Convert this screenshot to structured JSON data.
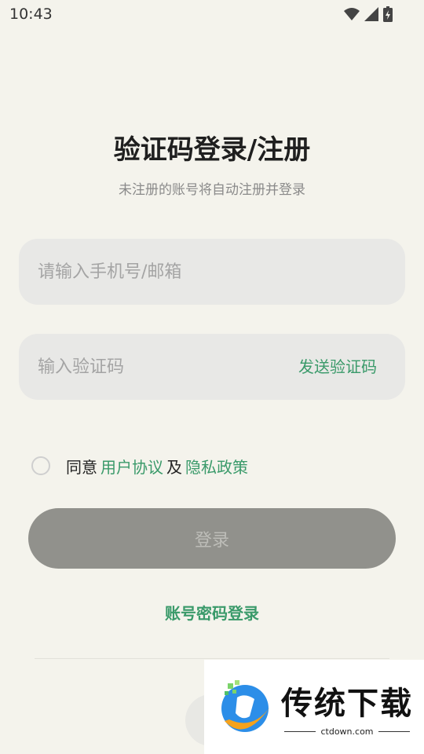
{
  "status_bar": {
    "time": "10:43"
  },
  "header": {
    "title": "验证码登录/注册",
    "subtitle": "未注册的账号将自动注册并登录"
  },
  "form": {
    "account_placeholder": "请输入手机号/邮箱",
    "account_value": "",
    "code_placeholder": "输入验证码",
    "code_value": "",
    "send_code_label": "发送验证码"
  },
  "agreement": {
    "checked": false,
    "prefix": "同意",
    "user_agreement": "用户协议",
    "and": "及",
    "privacy_policy": "隐私政策"
  },
  "login_button": "登录",
  "password_login": "账号密码登录",
  "watermark": {
    "title": "传统下载",
    "url": "ctdown.com"
  },
  "colors": {
    "background": "#f4f3ec",
    "accent": "#3a9a6a",
    "button_disabled": "#91918c",
    "field_bg": "#e8e8e6"
  }
}
